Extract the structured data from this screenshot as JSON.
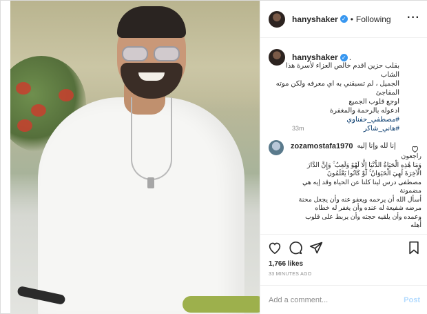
{
  "post": {
    "username": "hanyshaker",
    "verified_icon": "verified-badge-icon",
    "follow_separator": "•",
    "follow_label": "Following",
    "more_icon": "more-horizontal-icon",
    "more_label": "···"
  },
  "caption": {
    "username": "hanyshaker",
    "tail": ".",
    "lines": [
      "بقلب حزين اقدم خالص العزاء لأسرة هذا الشاب",
      "الجميل ، لم تسبقني به اي معرفه ولكن موته المفاجئ",
      "اوجع قلوب الجميع",
      "ادعوله بالرحمة والمغفرة"
    ],
    "hashtags": [
      "#مصطفي_حفناوي",
      "#هاني_شاكر"
    ],
    "time": "33m"
  },
  "reply": {
    "username": "zozamostafa1970",
    "inline_text": "إنا لله وإنا إليه",
    "heart_icon": "heart-outline-icon",
    "lines": [
      "راجعون",
      "وَمَا هَٰذِهِ الْحَيَاةُ الدُّنْيَا إِلَّا لَهْوٌ وَلَعِبٌ ۚ وَإِنَّ الدَّارَ",
      "الْآخِرَةَ لَهِيَ الْحَيَوَانُ ۚ لَوْ كَانُوا يَعْلَمُونَ",
      "مصطفى درس لينا كلنا عن الحياة وقد إيه هي",
      "مضمونة",
      "أسأل الله أن يرحمه ويعفو عنه وأن يجعل محنة",
      "مرضه شفيعة له عنده وأن يغفر له خطاه",
      "وعمده وأن يلقيه حجته وأن يربط على قلوب",
      "أهله"
    ]
  },
  "actions": {
    "like_icon": "heart-outline-icon",
    "comment_icon": "comment-bubble-icon",
    "share_icon": "paper-plane-icon",
    "save_icon": "bookmark-icon"
  },
  "likes": "1,766 likes",
  "posted_time": "33 MINUTES AGO",
  "comment_box": {
    "placeholder": "Add a comment...",
    "post_label": "Post"
  },
  "colors": {
    "link_blue": "#3897f0",
    "post_disabled": "#b3dbff",
    "hashtag": "#003569",
    "muted": "#8e8e8e"
  }
}
